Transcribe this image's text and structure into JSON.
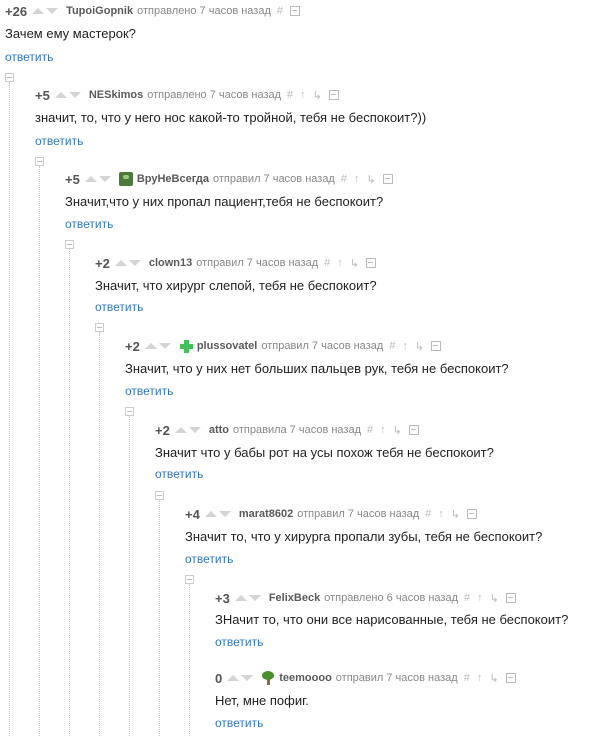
{
  "comments": [
    {
      "score": "+26",
      "user": "TupoiGopnik",
      "avatar": "",
      "meta": "отправлено 7 часов назад",
      "text": "Зачем ему мастерок?",
      "reply": "ответить"
    },
    {
      "score": "+5",
      "user": "NESkimos",
      "avatar": "",
      "meta": "отправлено 7 часов назад",
      "text": "значит, то, что у него нос какой-то тройной, тебя не беспокоит?))",
      "reply": "ответить"
    },
    {
      "score": "+5",
      "user": "ВруНеВсегда",
      "avatar": "frog",
      "meta": "отправил 7 часов назад",
      "text": "Значит,что у них пропал пациент,тебя не беспокоит?",
      "reply": "ответить"
    },
    {
      "score": "+2",
      "user": "clown13",
      "avatar": "",
      "meta": "отправил 7 часов назад",
      "text": "Значит, что хирург слепой, тебя не беспокоит?",
      "reply": "ответить"
    },
    {
      "score": "+2",
      "user": "plussovatel",
      "avatar": "plus",
      "meta": "отправил 7 часов назад",
      "text": "Значит, что у них нет больших пальцев рук, тебя не беспокоит?",
      "reply": "ответить"
    },
    {
      "score": "+2",
      "user": "atto",
      "avatar": "",
      "meta": "отправила 7 часов назад",
      "text": "Значит что у бабы рот на усы похож тебя не беспокоит?",
      "reply": "ответить"
    },
    {
      "score": "+4",
      "user": "marat8602",
      "avatar": "",
      "meta": "отправил 7 часов назад",
      "text": "Значит то, что у хирурга пропали зубы, тебя не беспокоит?",
      "reply": "ответить"
    },
    {
      "score": "+3",
      "user": "FelixBeck",
      "avatar": "",
      "meta": "отправлено 6 часов назад",
      "text": "ЗНачит то, что они все нарисованные, тебя не беспокоит?",
      "reply": "ответить"
    },
    {
      "score": "0",
      "user": "teemoooo",
      "avatar": "tree",
      "meta": "отправил 7 часов назад",
      "text": "Нет, мне пофиг.",
      "reply": "ответить"
    }
  ],
  "icons": {
    "hash": "#",
    "up": "↑",
    "branch": "↳",
    "save": "save-icon"
  }
}
